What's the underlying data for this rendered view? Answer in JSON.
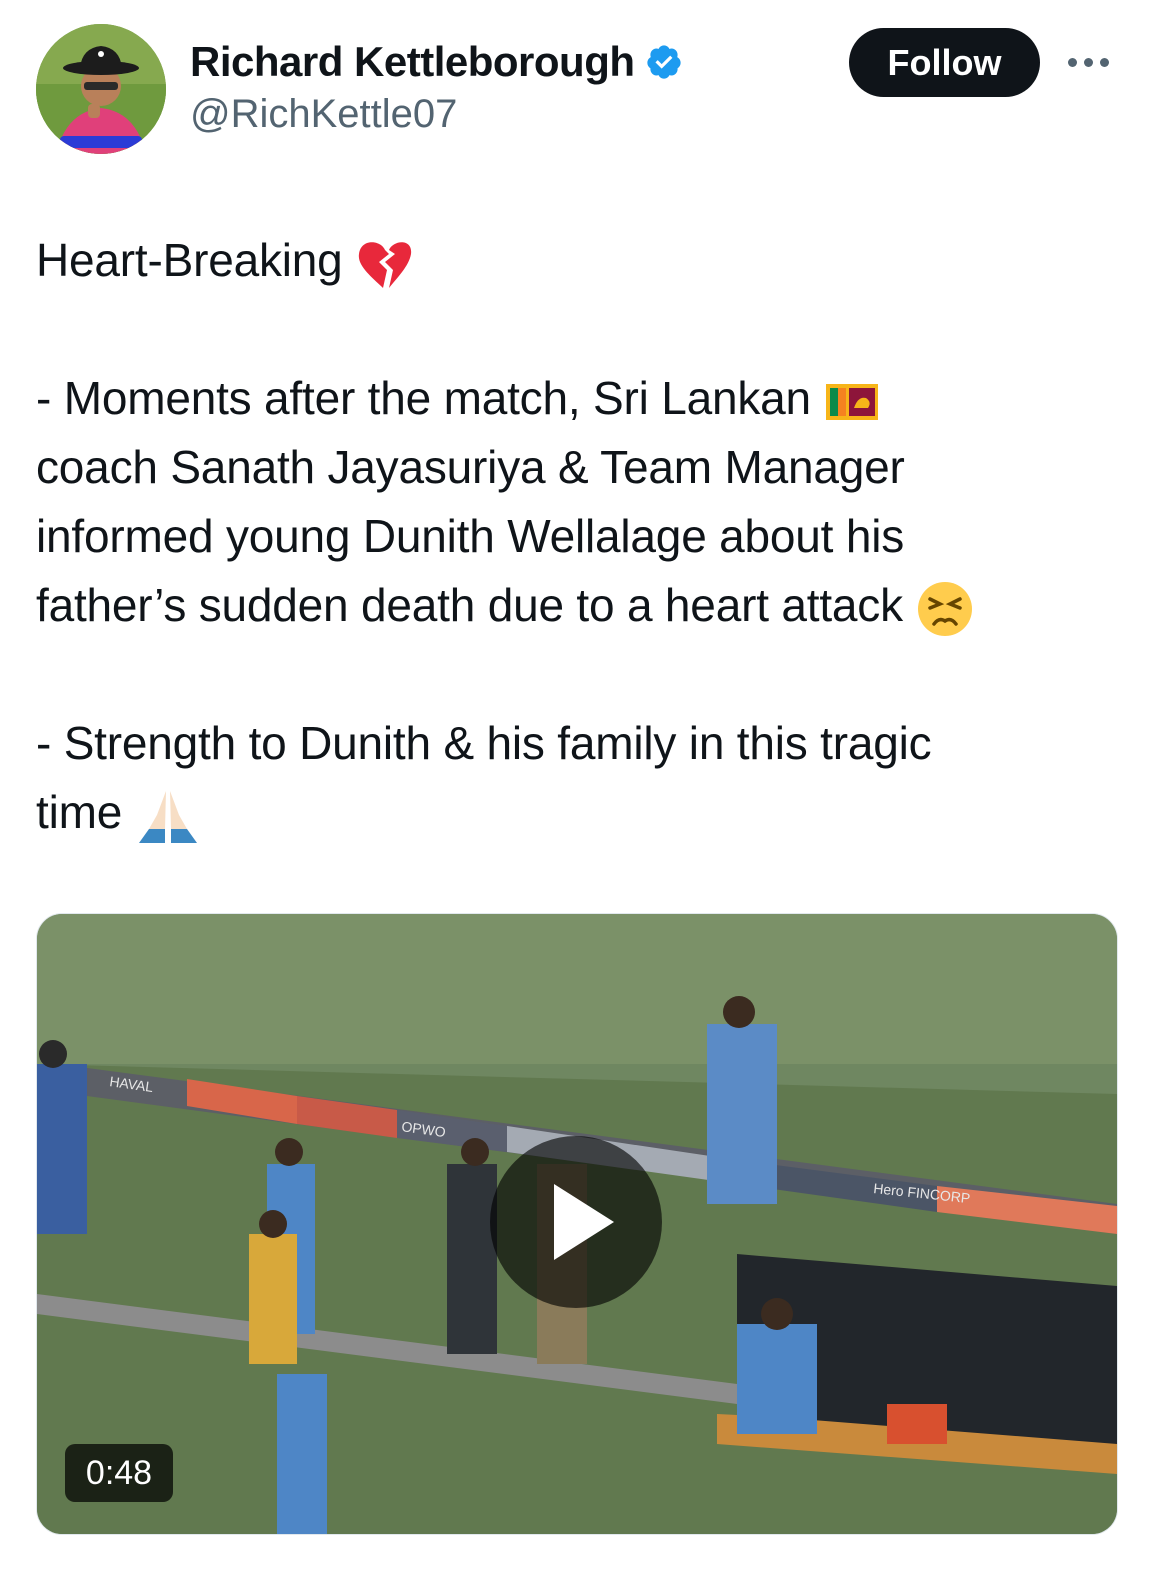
{
  "author": {
    "display_name": "Richard Kettleborough",
    "handle": "@RichKettle07",
    "verified": true,
    "avatar_icon": "umpire-avatar"
  },
  "actions": {
    "follow_label": "Follow",
    "more_icon": "more-dots-icon"
  },
  "tweet": {
    "line1": "Heart-Breaking",
    "line1_emoji": "broken-heart-emoji",
    "para2_line1": "- Moments after the match, Sri Lankan",
    "para2_line1_emoji": "sri-lanka-flag-emoji",
    "para2_line2": "coach Sanath Jayasuriya & Team Manager",
    "para2_line3": "informed young Dunith Wellalage about his",
    "para2_line4": "father’s sudden death due to a heart attack",
    "para2_line4_emoji": "persevering-face-emoji",
    "para3_line1": "- Strength to Dunith & his family in this tragic",
    "para3_line2": "time",
    "para3_line2_emoji": "folded-hands-emoji"
  },
  "media": {
    "type": "video",
    "duration": "0:48",
    "board_texts": [
      "HAVAL",
      "OPWO",
      "Hero FINCORP"
    ]
  },
  "colors": {
    "text": "#0f1419",
    "secondary": "#536471",
    "verified": "#1d9bf0",
    "button": "#0f1419"
  }
}
